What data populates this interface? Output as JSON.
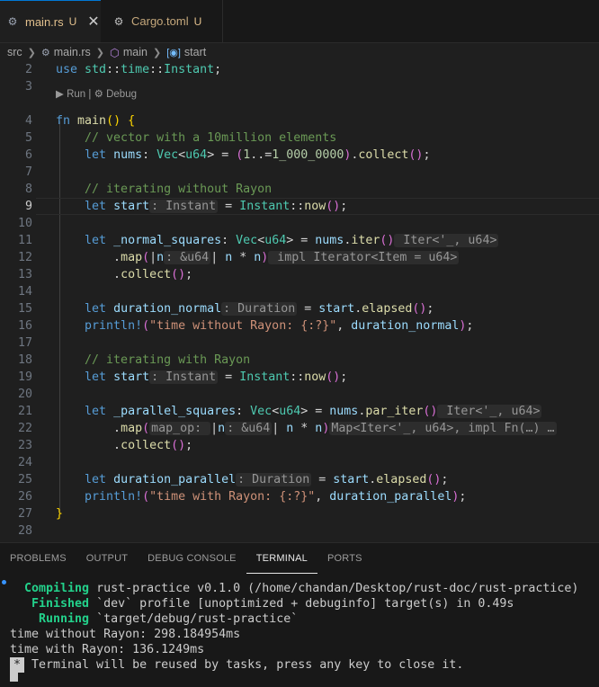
{
  "tabs": [
    {
      "name": "main.rs",
      "status": "U",
      "icon": "rust-file-icon",
      "active": true
    },
    {
      "name": "Cargo.toml",
      "status": "U",
      "icon": "gear-icon",
      "active": false
    }
  ],
  "tab_close_glyph": "✕",
  "breadcrumb": {
    "folder": "src",
    "file": "main.rs",
    "module": "main",
    "symbol": "start"
  },
  "codelens": {
    "run": "Run",
    "sep": "|",
    "debug": "Debug"
  },
  "current_line": 9,
  "lines": [
    {
      "n": 2,
      "s": [
        [
          "kw",
          "use "
        ],
        [
          "ty",
          "std"
        ],
        [
          "pl",
          "::"
        ],
        [
          "ty",
          "time"
        ],
        [
          "pl",
          "::"
        ],
        [
          "ty",
          "Instant"
        ],
        [
          "pl",
          ";"
        ]
      ]
    },
    {
      "n": 3,
      "s": []
    },
    {
      "n": 4,
      "s": [
        [
          "kw",
          "fn "
        ],
        [
          "fn",
          "main"
        ],
        [
          "br1",
          "()"
        ],
        [
          "pl",
          " "
        ],
        [
          "br1",
          "{"
        ]
      ]
    },
    {
      "n": 5,
      "s": [
        [
          "pl",
          "    "
        ],
        [
          "cm",
          "// vector with a 10million elements"
        ]
      ]
    },
    {
      "n": 6,
      "s": [
        [
          "pl",
          "    "
        ],
        [
          "kw",
          "let "
        ],
        [
          "var",
          "nums"
        ],
        [
          "pl",
          ": "
        ],
        [
          "ty",
          "Vec"
        ],
        [
          "pl",
          "<"
        ],
        [
          "ty",
          "u64"
        ],
        [
          "pl",
          "> = "
        ],
        [
          "br2",
          "("
        ],
        [
          "num",
          "1"
        ],
        [
          "pl",
          "..="
        ],
        [
          "num",
          "1_000_0000"
        ],
        [
          "br2",
          ")"
        ],
        [
          "pl",
          "."
        ],
        [
          "fn",
          "collect"
        ],
        [
          "br2",
          "()"
        ],
        [
          "pl",
          ";"
        ]
      ]
    },
    {
      "n": 7,
      "s": []
    },
    {
      "n": 8,
      "s": [
        [
          "pl",
          "    "
        ],
        [
          "cm",
          "// iterating without Rayon"
        ]
      ]
    },
    {
      "n": 9,
      "s": [
        [
          "pl",
          "    "
        ],
        [
          "kw",
          "let "
        ],
        [
          "var",
          "start"
        ],
        [
          "hint",
          ": Instant"
        ],
        [
          "pl",
          " = "
        ],
        [
          "ty",
          "Instant"
        ],
        [
          "pl",
          "::"
        ],
        [
          "fn",
          "now"
        ],
        [
          "br2",
          "()"
        ],
        [
          "pl",
          ";"
        ]
      ]
    },
    {
      "n": 10,
      "s": []
    },
    {
      "n": 11,
      "s": [
        [
          "pl",
          "    "
        ],
        [
          "kw",
          "let "
        ],
        [
          "var",
          "_normal_squares"
        ],
        [
          "pl",
          ": "
        ],
        [
          "ty",
          "Vec"
        ],
        [
          "pl",
          "<"
        ],
        [
          "ty",
          "u64"
        ],
        [
          "pl",
          "> = "
        ],
        [
          "var",
          "nums"
        ],
        [
          "pl",
          "."
        ],
        [
          "fn",
          "iter"
        ],
        [
          "br2",
          "()"
        ],
        [
          "hint",
          " Iter<'_, u64>"
        ]
      ]
    },
    {
      "n": 12,
      "s": [
        [
          "pl",
          "        ."
        ],
        [
          "fn",
          "map"
        ],
        [
          "br2",
          "("
        ],
        [
          "pl",
          "|"
        ],
        [
          "var",
          "n"
        ],
        [
          "hint",
          ": &u64"
        ],
        [
          "pl",
          "| "
        ],
        [
          "var",
          "n"
        ],
        [
          "pl",
          " * "
        ],
        [
          "var",
          "n"
        ],
        [
          "br2",
          ")"
        ],
        [
          "hint",
          " impl Iterator<Item = u64>"
        ]
      ]
    },
    {
      "n": 13,
      "s": [
        [
          "pl",
          "        ."
        ],
        [
          "fn",
          "collect"
        ],
        [
          "br2",
          "()"
        ],
        [
          "pl",
          ";"
        ]
      ]
    },
    {
      "n": 14,
      "s": []
    },
    {
      "n": 15,
      "s": [
        [
          "pl",
          "    "
        ],
        [
          "kw",
          "let "
        ],
        [
          "var",
          "duration_normal"
        ],
        [
          "hint",
          ": Duration"
        ],
        [
          "pl",
          " = "
        ],
        [
          "var",
          "start"
        ],
        [
          "pl",
          "."
        ],
        [
          "fn",
          "elapsed"
        ],
        [
          "br2",
          "()"
        ],
        [
          "pl",
          ";"
        ]
      ]
    },
    {
      "n": 16,
      "s": [
        [
          "pl",
          "    "
        ],
        [
          "mac",
          "println!"
        ],
        [
          "br2",
          "("
        ],
        [
          "str",
          "\"time without Rayon: {:?}\""
        ],
        [
          "pl",
          ", "
        ],
        [
          "var",
          "duration_normal"
        ],
        [
          "br2",
          ")"
        ],
        [
          "pl",
          ";"
        ]
      ]
    },
    {
      "n": 17,
      "s": []
    },
    {
      "n": 18,
      "s": [
        [
          "pl",
          "    "
        ],
        [
          "cm",
          "// iterating with Rayon"
        ]
      ]
    },
    {
      "n": 19,
      "s": [
        [
          "pl",
          "    "
        ],
        [
          "kw",
          "let "
        ],
        [
          "var",
          "start"
        ],
        [
          "hint",
          ": Instant"
        ],
        [
          "pl",
          " = "
        ],
        [
          "ty",
          "Instant"
        ],
        [
          "pl",
          "::"
        ],
        [
          "fn",
          "now"
        ],
        [
          "br2",
          "()"
        ],
        [
          "pl",
          ";"
        ]
      ]
    },
    {
      "n": 20,
      "s": []
    },
    {
      "n": 21,
      "s": [
        [
          "pl",
          "    "
        ],
        [
          "kw",
          "let "
        ],
        [
          "var",
          "_parallel_squares"
        ],
        [
          "pl",
          ": "
        ],
        [
          "ty",
          "Vec"
        ],
        [
          "pl",
          "<"
        ],
        [
          "ty",
          "u64"
        ],
        [
          "pl",
          "> = "
        ],
        [
          "var",
          "nums"
        ],
        [
          "pl",
          "."
        ],
        [
          "fn",
          "par_iter"
        ],
        [
          "br2",
          "()"
        ],
        [
          "hint",
          " Iter<'_, u64>"
        ]
      ]
    },
    {
      "n": 22,
      "s": [
        [
          "pl",
          "        ."
        ],
        [
          "fn",
          "map"
        ],
        [
          "br2",
          "("
        ],
        [
          "hint",
          "map_op: "
        ],
        [
          "pl",
          "|"
        ],
        [
          "var",
          "n"
        ],
        [
          "hint",
          ": &u64"
        ],
        [
          "pl",
          "| "
        ],
        [
          "var",
          "n"
        ],
        [
          "pl",
          " * "
        ],
        [
          "var",
          "n"
        ],
        [
          "br2",
          ")"
        ],
        [
          "hint",
          "Map<Iter<'_, u64>, impl Fn(…) …"
        ]
      ]
    },
    {
      "n": 23,
      "s": [
        [
          "pl",
          "        ."
        ],
        [
          "fn",
          "collect"
        ],
        [
          "br2",
          "()"
        ],
        [
          "pl",
          ";"
        ]
      ]
    },
    {
      "n": 24,
      "s": []
    },
    {
      "n": 25,
      "s": [
        [
          "pl",
          "    "
        ],
        [
          "kw",
          "let "
        ],
        [
          "var",
          "duration_parallel"
        ],
        [
          "hint",
          ": Duration"
        ],
        [
          "pl",
          " = "
        ],
        [
          "var",
          "start"
        ],
        [
          "pl",
          "."
        ],
        [
          "fn",
          "elapsed"
        ],
        [
          "br2",
          "()"
        ],
        [
          "pl",
          ";"
        ]
      ]
    },
    {
      "n": 26,
      "s": [
        [
          "pl",
          "    "
        ],
        [
          "mac",
          "println!"
        ],
        [
          "br2",
          "("
        ],
        [
          "str",
          "\"time with Rayon: {:?}\""
        ],
        [
          "pl",
          ", "
        ],
        [
          "var",
          "duration_parallel"
        ],
        [
          "br2",
          ")"
        ],
        [
          "pl",
          ";"
        ]
      ]
    },
    {
      "n": 27,
      "s": [
        [
          "br1",
          "}"
        ]
      ]
    },
    {
      "n": 28,
      "s": []
    }
  ],
  "panel_tabs": [
    "PROBLEMS",
    "OUTPUT",
    "DEBUG CONSOLE",
    "TERMINAL",
    "PORTS"
  ],
  "active_panel_tab": "TERMINAL",
  "terminal": [
    {
      "k": "  Compiling",
      "t": " rust-practice v0.1.0 (/home/chandan/Desktop/rust-doc/rust-practice)"
    },
    {
      "k": "   Finished",
      "t": " `dev` profile [unoptimized + debuginfo] target(s) in 0.49s"
    },
    {
      "k": "    Running",
      "t": " `target/debug/rust-practice`"
    },
    {
      "k": "",
      "t": "time without Rayon: 298.184954ms"
    },
    {
      "k": "",
      "t": "time with Rayon: 136.1249ms"
    }
  ],
  "terminal_notice": {
    "badge": "*",
    "text": " Terminal will be reused by tasks, press any key to close it."
  },
  "colors": {
    "accent": "#0078d4",
    "modified": "#e2c08d",
    "cargo_green": "#23d18b"
  }
}
